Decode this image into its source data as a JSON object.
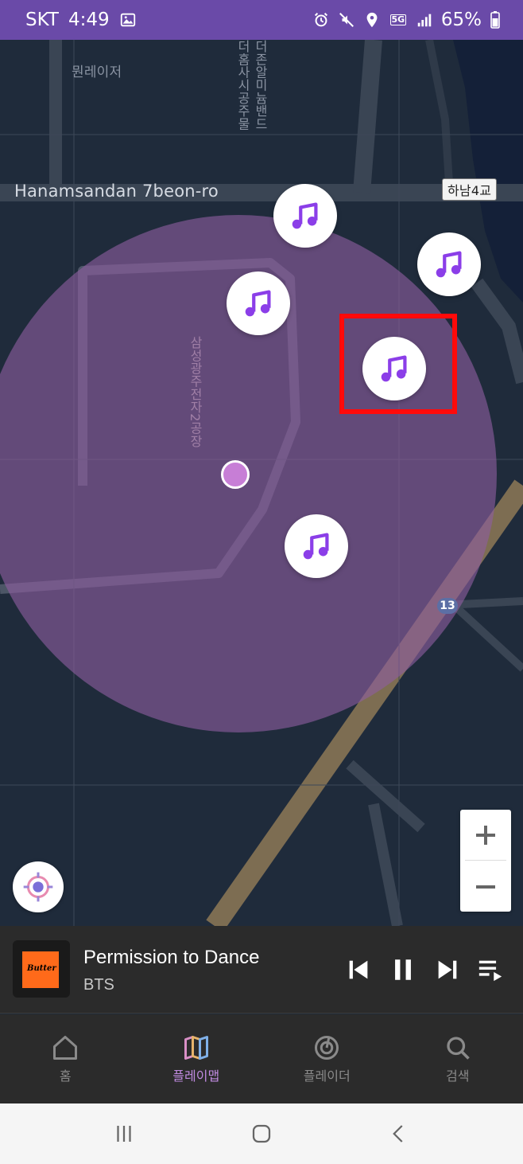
{
  "status_bar": {
    "carrier": "SKT",
    "time": "4:49",
    "network": "5G",
    "battery": "65%",
    "icons": [
      "gallery-icon",
      "alarm-icon",
      "mute-icon",
      "location-icon",
      "signal-icon",
      "battery-icon"
    ]
  },
  "map": {
    "labels": {
      "street": "Hanamsandan 7beon-ro",
      "place_top": "뭔레이저",
      "vertical_top": "더홈사시공주물",
      "vertical_top2": "더존알미늄밴드",
      "factory": "삼성광주전자2공장",
      "bridge": "하남4교",
      "route": "13"
    },
    "markers": [
      "music-marker",
      "music-marker",
      "music-marker",
      "music-marker",
      "music-marker"
    ],
    "circle_color": "#8e5d9f"
  },
  "player": {
    "album_text": "Butter",
    "title": "Permission to Dance",
    "artist": "BTS"
  },
  "nav": {
    "items": [
      {
        "label": "홈",
        "icon": "home-icon",
        "active": false
      },
      {
        "label": "플레이맵",
        "icon": "map-icon",
        "active": true
      },
      {
        "label": "플레이더",
        "icon": "radar-icon",
        "active": false
      },
      {
        "label": "검색",
        "icon": "search-icon",
        "active": false
      }
    ]
  },
  "colors": {
    "accent": "#c08be0",
    "status_bar": "#6a4aa8",
    "highlight": "#ff0a0a",
    "music_icon": "#8b3ee8"
  }
}
